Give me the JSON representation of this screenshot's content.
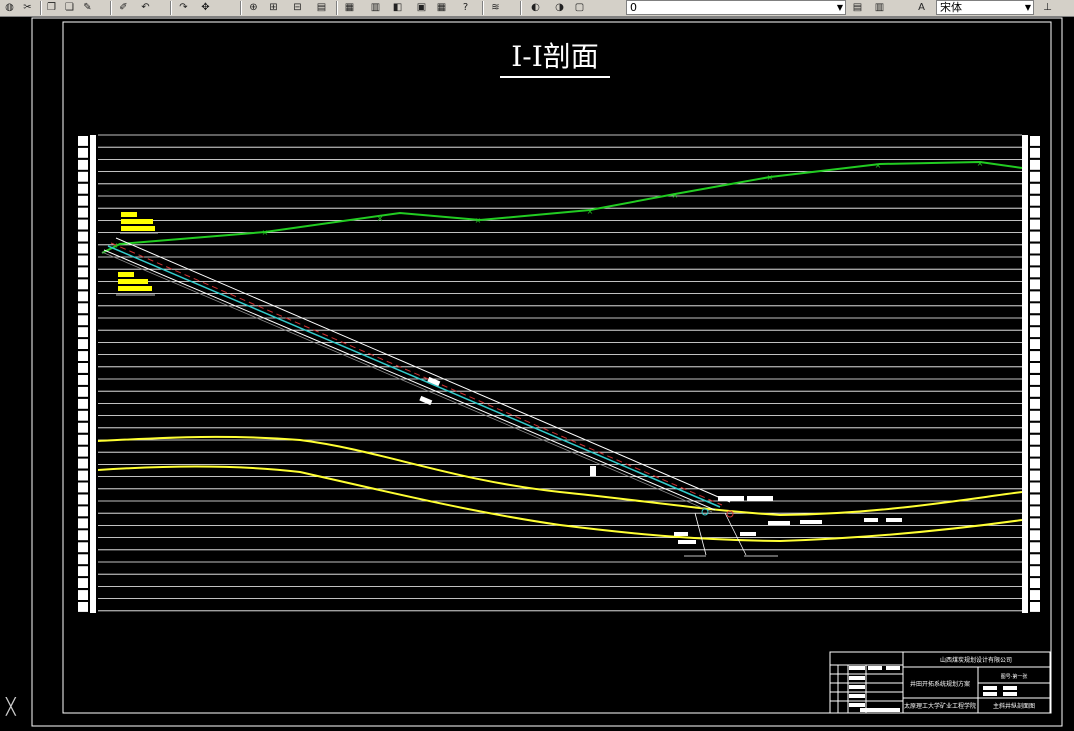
{
  "toolbar": {
    "layer_value": "0",
    "font_value": "宋体",
    "buttons": [
      "pan-icon",
      "cut-icon",
      "copy-icon",
      "paste-icon",
      "match-properties-icon",
      "brush-icon",
      "undo-icon",
      "redo-icon",
      "pan-realtime-icon",
      "zoom-realtime-icon",
      "zoom-window-icon",
      "zoom-previous-icon",
      "properties-icon",
      "design-center-icon",
      "tool-palettes-icon",
      "sheet-set-icon",
      "markup-icon",
      "calculator-icon",
      "help-icon",
      "layer-manager-icon",
      "layer-state-icon"
    ],
    "icon_glyphs": {
      "pan": "✋",
      "cut": "✂",
      "copy": "❐",
      "paste": "📋",
      "match": "✎",
      "brush": "🖌",
      "undo": "↶",
      "redo": "↷",
      "help": "?"
    }
  },
  "drawing": {
    "title": "Ⅰ-Ⅰ剖面",
    "colors": {
      "background": "#000000",
      "border": "#ffffff",
      "grid": "#ffffff",
      "surface": "#22cc22",
      "seam": "#ffff33",
      "annotation_yellow": "#ffff00",
      "shaft_red": "#cc3333",
      "shaft_cyan": "#33cccc"
    },
    "title_block": {
      "company": "山西煤炭规划设计有限公司",
      "project": "井田开拓系统规划方案",
      "school": "太原理工大学矿业工程学院",
      "drawing_name": "主斜井纵剖面图",
      "drawing_no": "图号-第一张"
    }
  }
}
